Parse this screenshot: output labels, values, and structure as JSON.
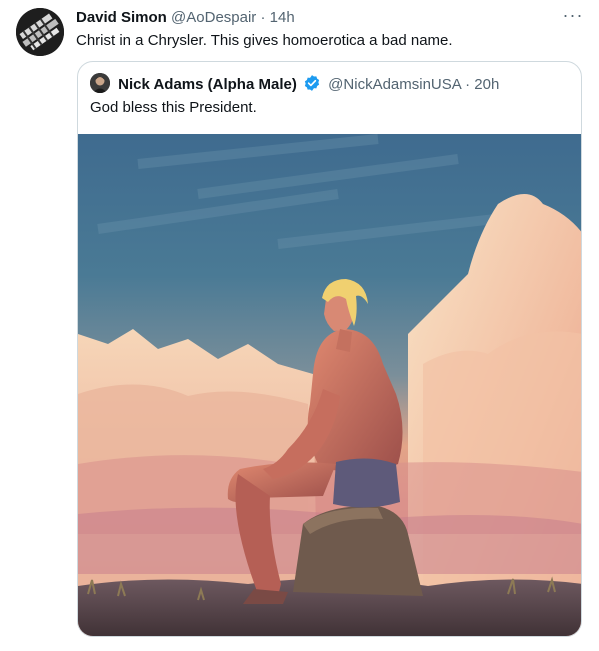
{
  "tweet": {
    "author_name": "David Simon",
    "author_handle": "@AoDespair",
    "separator": "·",
    "time": "14h",
    "text": "Christ in a Chrysler. This gives homoerotica a bad name.",
    "more_label": "···"
  },
  "quoted": {
    "author_name": "Nick Adams (Alpha Male)",
    "author_handle": "@NickAdamsinUSA",
    "separator": "·",
    "time": "20h",
    "text": "God bless this President."
  },
  "icons": {
    "more": "more-horizontal-icon",
    "verified": "verified-badge-icon"
  },
  "colors": {
    "text": "#0f1419",
    "muted": "#536471",
    "verified": "#1d9bf0",
    "border": "#cfd9de"
  }
}
